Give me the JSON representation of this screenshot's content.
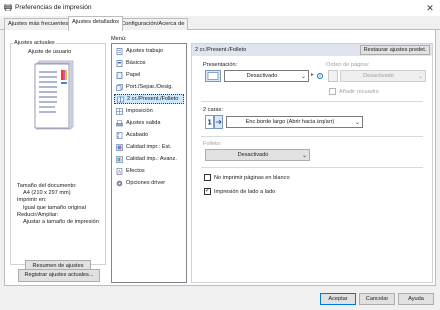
{
  "window": {
    "title": "Preferencias de impresión",
    "close_glyph": "✕"
  },
  "tabs": [
    {
      "label": "Ajustes más frecuentes"
    },
    {
      "label": "Ajustes detallados"
    },
    {
      "label": "Configuración/Acerca de"
    }
  ],
  "left": {
    "group_label": "Ajustes actuales",
    "preset": "Ajuste de usuario",
    "summary_lines": [
      "Tamaño del documento:",
      "  A4 (210 x 297 mm)",
      "Imprimir en:",
      "  Igual que tamaño original",
      "Reducir/Ampliar:",
      "  Ajustar a tamaño de impresión"
    ],
    "summary_button": "Resumen de ajustes",
    "register_button": "Registrar ajustes actuales..."
  },
  "menu": {
    "label": "Menú:",
    "items": [
      {
        "label": "Ajustes trabajo",
        "icon": "job-settings-icon"
      },
      {
        "label": "Básicos",
        "icon": "basic-icon"
      },
      {
        "label": "Papel",
        "icon": "paper-icon"
      },
      {
        "label": "Port./Separ./Desig.",
        "icon": "cover-icon"
      },
      {
        "label": "2 cr./Present./Folleto",
        "icon": "duplex-icon"
      },
      {
        "label": "Imposición",
        "icon": "imposition-icon"
      },
      {
        "label": "Ajustes salida",
        "icon": "output-icon"
      },
      {
        "label": "Acabado",
        "icon": "finishing-icon"
      },
      {
        "label": "Calidad impr.: Est.",
        "icon": "quality-standard-icon"
      },
      {
        "label": "Calidad imp.: Avanz.",
        "icon": "quality-advanced-icon"
      },
      {
        "label": "Efectos",
        "icon": "effects-icon"
      },
      {
        "label": "Opciones driver",
        "icon": "driver-options-icon"
      }
    ],
    "selected_index": 4
  },
  "panel": {
    "header": "2 cr./Present./Folleto",
    "restore_button": "Restaurar ajustes predet.",
    "presentacion": {
      "label": "Presentación:",
      "value": "Desactivado"
    },
    "orden": {
      "label": "Orden de página:",
      "value": "Desactivado"
    },
    "recuadro": {
      "label": "Añadir recuadro",
      "checked": false
    },
    "dos_caras": {
      "label": "2 caras:",
      "value": "Enc.borde largo (Abrir hacia izq/arr)"
    },
    "folleto": {
      "label": "Folleto:",
      "value": "Desactivado"
    },
    "blank_pages": {
      "label": "No imprimir páginas en blanco",
      "checked": false
    },
    "side_by_side": {
      "label": "Impresión de lado a lado",
      "checked": true
    }
  },
  "footer": {
    "accept": "Aceptar",
    "cancel": "Cancelar",
    "help": "Ayuda"
  },
  "colors": {
    "selection": "#cce8ff",
    "accent": "#0078d7",
    "info": "#1a6fc4"
  }
}
